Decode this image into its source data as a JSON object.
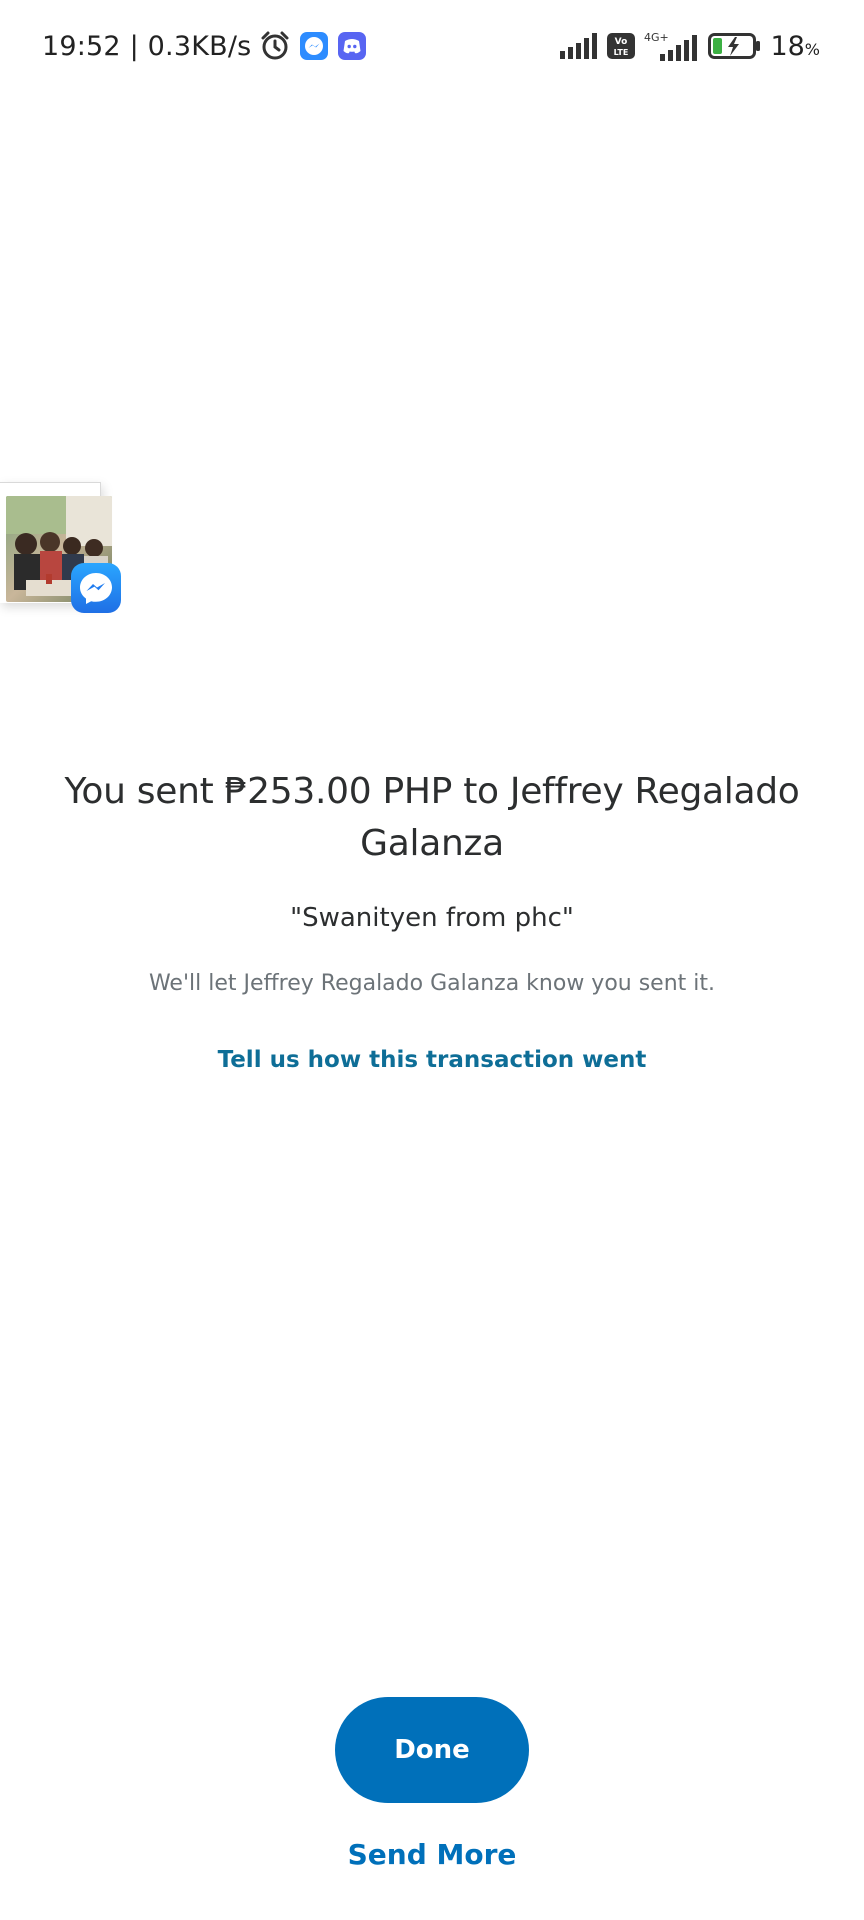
{
  "status_bar": {
    "time_and_speed": "19:52 | 0.3KB/s",
    "battery_percent": "18",
    "battery_unit": "%",
    "network_label": "4G+",
    "volte_label": "Vo LTE",
    "icons": [
      "alarm-icon",
      "messenger-notification-icon",
      "discord-notification-icon",
      "signal-icon",
      "volte-icon",
      "signal-4g-icon",
      "battery-charging-icon"
    ]
  },
  "chat_head": {
    "icon": "messenger-icon",
    "colors": {
      "messenger_start": "#2aa6ff",
      "messenger_end": "#1f6fe5"
    }
  },
  "confirmation": {
    "title": "You sent ₱253.00 PHP to Jeffrey Regalado Galanza",
    "note": "\"Swanityen from phc\"",
    "subtext": "We'll let Jeffrey Regalado Galanza know you sent it.",
    "feedback_link": "Tell us how this transaction went"
  },
  "actions": {
    "done_label": "Done",
    "send_more_label": "Send More"
  },
  "colors": {
    "primary_button": "#0070ba",
    "link": "#0070ba",
    "feedback_link": "#0e6e97",
    "title_text": "#2c2e2f",
    "secondary_text": "#6c7378"
  }
}
